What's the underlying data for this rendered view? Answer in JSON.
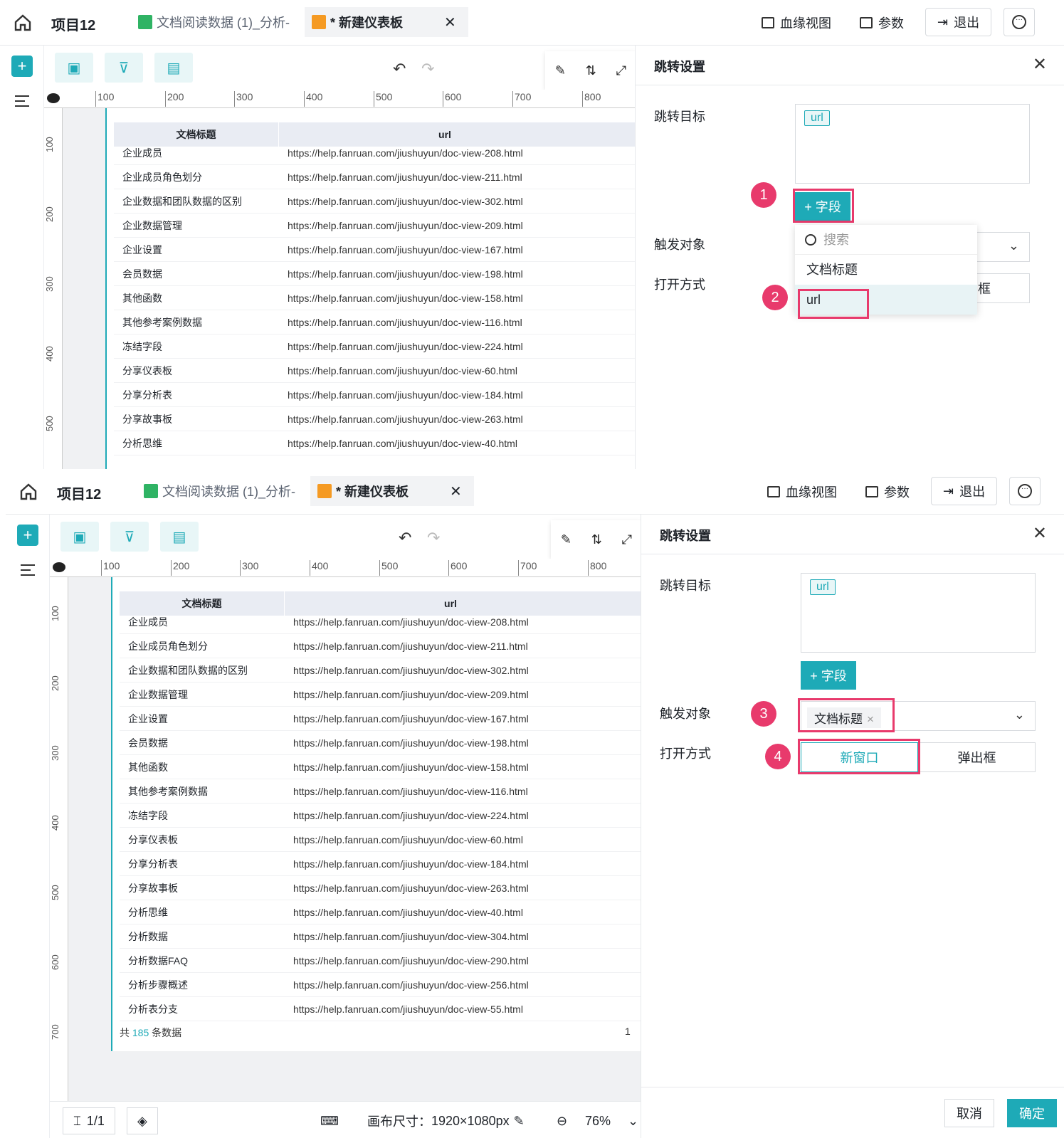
{
  "topbar": {
    "project": "项目12",
    "tab1": "文档阅读数据 (1)_分析-",
    "tab2": "* 新建仪表板",
    "tab_close": "✕",
    "lineage": "血缘视图",
    "params": "参数",
    "exit": "退出"
  },
  "ruler": {
    "h": [
      "100",
      "200",
      "300",
      "400",
      "500",
      "600",
      "700",
      "800"
    ],
    "v1": [
      "100",
      "200",
      "300",
      "400",
      "500"
    ],
    "v2": [
      "100",
      "200",
      "300",
      "400",
      "500",
      "600",
      "700"
    ]
  },
  "table": {
    "headers": [
      "文档标题",
      "url"
    ],
    "rows": [
      [
        "企业成员",
        "https://help.fanruan.com/jiushuyun/doc-view-208.html"
      ],
      [
        "企业成员角色划分",
        "https://help.fanruan.com/jiushuyun/doc-view-211.html"
      ],
      [
        "企业数据和团队数据的区别",
        "https://help.fanruan.com/jiushuyun/doc-view-302.html"
      ],
      [
        "企业数据管理",
        "https://help.fanruan.com/jiushuyun/doc-view-209.html"
      ],
      [
        "企业设置",
        "https://help.fanruan.com/jiushuyun/doc-view-167.html"
      ],
      [
        "会员数据",
        "https://help.fanruan.com/jiushuyun/doc-view-198.html"
      ],
      [
        "其他函数",
        "https://help.fanruan.com/jiushuyun/doc-view-158.html"
      ],
      [
        "其他参考案例数据",
        "https://help.fanruan.com/jiushuyun/doc-view-116.html"
      ],
      [
        "冻结字段",
        "https://help.fanruan.com/jiushuyun/doc-view-224.html"
      ],
      [
        "分享仪表板",
        "https://help.fanruan.com/jiushuyun/doc-view-60.html"
      ],
      [
        "分享分析表",
        "https://help.fanruan.com/jiushuyun/doc-view-184.html"
      ],
      [
        "分享故事板",
        "https://help.fanruan.com/jiushuyun/doc-view-263.html"
      ],
      [
        "分析思维",
        "https://help.fanruan.com/jiushuyun/doc-view-40.html"
      ],
      [
        "分析数据",
        "https://help.fanruan.com/jiushuyun/doc-view-304.html"
      ],
      [
        "分析数据FAQ",
        "https://help.fanruan.com/jiushuyun/doc-view-290.html"
      ],
      [
        "分析步骤概述",
        "https://help.fanruan.com/jiushuyun/doc-view-256.html"
      ],
      [
        "分析表分支",
        "https://help.fanruan.com/jiushuyun/doc-view-55.html"
      ]
    ],
    "footer_prefix": "共",
    "footer_count": "185",
    "footer_suffix": "条数据",
    "page_num": "1"
  },
  "panel": {
    "title": "跳转设置",
    "target_label": "跳转目标",
    "target_tag": "url",
    "field_button": "+ 字段",
    "trigger_label": "触发对象",
    "open_label": "打开方式",
    "search_placeholder": "搜索",
    "options": [
      "文档标题",
      "url"
    ],
    "trigger_value": "文档标题",
    "open_new": "新窗口",
    "open_popup": "弹出框",
    "open_popup_partial": "框",
    "cancel": "取消",
    "ok": "确定"
  },
  "badges": [
    "1",
    "2",
    "3",
    "4"
  ],
  "bottombar": {
    "pages": "1/1",
    "canvas_label": "画布尺寸：",
    "canvas_size": "1920×1080px",
    "zoom": "76%"
  },
  "colors": {
    "accent": "#1eaab7",
    "highlight": "#e83a6c"
  }
}
